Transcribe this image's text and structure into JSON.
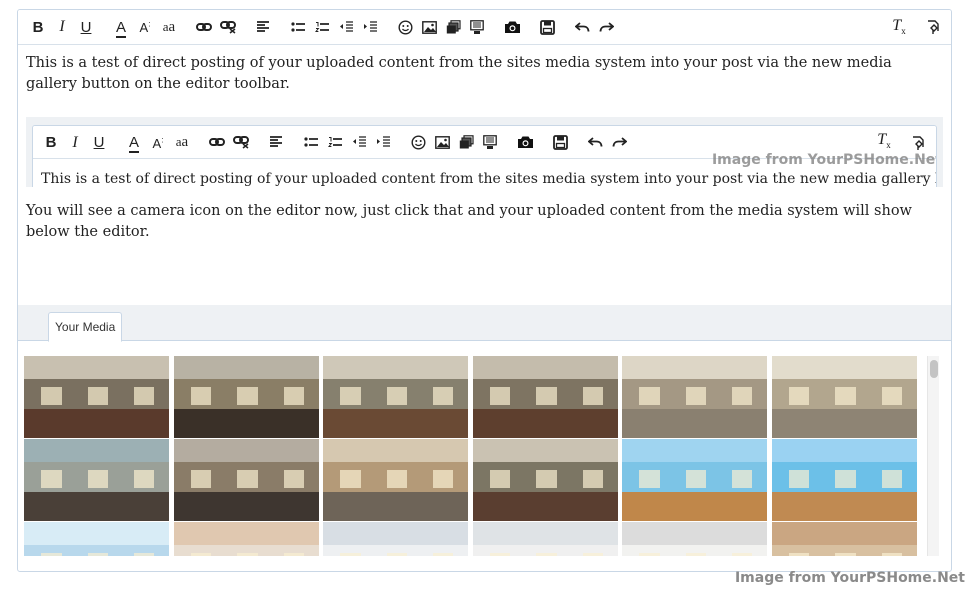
{
  "toolbar": {
    "buttons": [
      {
        "name": "bold",
        "icon": "bold-icon",
        "glyph": "B"
      },
      {
        "name": "italic",
        "icon": "italic-icon",
        "glyph": "I"
      },
      {
        "name": "underline",
        "icon": "underline-icon",
        "glyph": "U"
      },
      {
        "name": "text-color",
        "icon": "text-color-icon",
        "glyph": "A"
      },
      {
        "name": "font-size",
        "icon": "font-size-icon",
        "glyph": "A:"
      },
      {
        "name": "font-family",
        "icon": "font-family-icon",
        "glyph": "aa"
      },
      {
        "name": "link",
        "icon": "link-icon",
        "glyph": "link"
      },
      {
        "name": "unlink",
        "icon": "unlink-icon",
        "glyph": "unlink"
      },
      {
        "name": "align",
        "icon": "align-left-icon",
        "glyph": "align"
      },
      {
        "name": "bullet-list",
        "icon": "bullet-list-icon",
        "glyph": "ul"
      },
      {
        "name": "numbered-list",
        "icon": "numbered-list-icon",
        "glyph": "ol"
      },
      {
        "name": "outdent",
        "icon": "outdent-icon",
        "glyph": "outdent"
      },
      {
        "name": "indent",
        "icon": "indent-icon",
        "glyph": "indent"
      },
      {
        "name": "smilies",
        "icon": "smiley-icon",
        "glyph": "☺"
      },
      {
        "name": "image",
        "icon": "image-icon",
        "glyph": "img"
      },
      {
        "name": "media",
        "icon": "media-icon",
        "glyph": "media"
      },
      {
        "name": "insert",
        "icon": "insert-icon",
        "glyph": "insert"
      },
      {
        "name": "media-gallery",
        "icon": "camera-icon",
        "glyph": "camera"
      },
      {
        "name": "save",
        "icon": "save-icon",
        "glyph": "save"
      },
      {
        "name": "undo",
        "icon": "undo-icon",
        "glyph": "undo"
      },
      {
        "name": "redo",
        "icon": "redo-icon",
        "glyph": "redo"
      }
    ],
    "right_buttons": [
      {
        "name": "remove-formatting",
        "icon": "clear-formatting-icon",
        "glyph": "Tx"
      },
      {
        "name": "toggle-bbcode",
        "icon": "toggle-bbcode-icon",
        "glyph": "toggle"
      }
    ]
  },
  "content": {
    "paragraph1": "This is a test of direct posting of your uploaded content from the sites media system into your post via the new media gallery button on the editor toolbar.",
    "quoted_editor_text": "This is a test of direct posting of your uploaded content from the sites media system into your post via the new media gallery button on the",
    "paragraph2": "You will see a camera icon on the editor now, just click that and your uploaded content from the media system will show below the editor."
  },
  "media": {
    "tab_label": "Your Media",
    "thumbnails": [
      {
        "floor": "#5a3a2c",
        "wall": "#7a7060",
        "ceil": "#c8c0b0"
      },
      {
        "floor": "#3a3028",
        "wall": "#8a7e66",
        "ceil": "#b8b2a4"
      },
      {
        "floor": "#6a4a34",
        "wall": "#86806e",
        "ceil": "#cfc8b8"
      },
      {
        "floor": "#5e3f2e",
        "wall": "#7e7462",
        "ceil": "#c4bcac"
      },
      {
        "floor": "#8a8070",
        "wall": "#a49884",
        "ceil": "#ddd6c6"
      },
      {
        "floor": "#8e8474",
        "wall": "#b2a68e",
        "ceil": "#e2dccc"
      },
      {
        "floor": "#4a4038",
        "wall": "#9aa098",
        "ceil": "#9cb0b4"
      },
      {
        "floor": "#3e3630",
        "wall": "#8a7c68",
        "ceil": "#b4aca0"
      },
      {
        "floor": "#6e6458",
        "wall": "#b49a78",
        "ceil": "#d6c8b0"
      },
      {
        "floor": "#5a3e30",
        "wall": "#7c7664",
        "ceil": "#cac2b2"
      },
      {
        "floor": "#c0874a",
        "wall": "#7cc4e6",
        "ceil": "#9fd4f0"
      },
      {
        "floor": "#c08a52",
        "wall": "#6cc0e8",
        "ceil": "#9ad2f2"
      },
      {
        "floor": "#8ab8d8",
        "wall": "#b8d8ec",
        "ceil": "#d8ecf6"
      },
      {
        "floor": "#d8cdbf",
        "wall": "#e8ddd0",
        "ceil": "#e0c8b0"
      },
      {
        "floor": "#e4e2de",
        "wall": "#eef0f2",
        "ceil": "#d8dee4"
      },
      {
        "floor": "#e6e4e0",
        "wall": "#f0f0f0",
        "ceil": "#dfe3e6"
      },
      {
        "floor": "#e2e2e0",
        "wall": "#f2f2f0",
        "ceil": "#dcdcdc"
      },
      {
        "floor": "#b88658",
        "wall": "#d8c0a0",
        "ceil": "#caa682"
      }
    ]
  },
  "watermark": "Image from YourPSHome.Net"
}
